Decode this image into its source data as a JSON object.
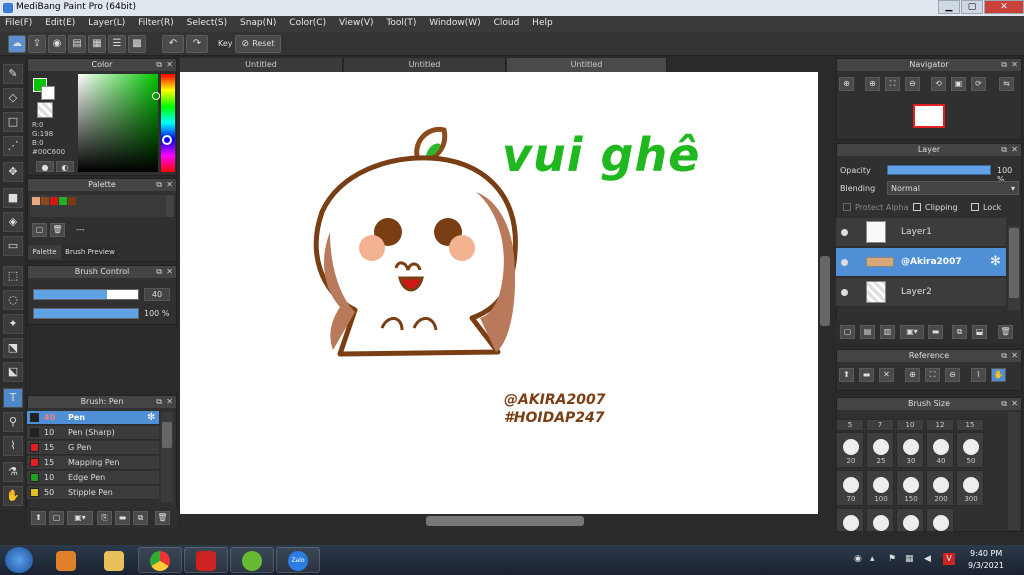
{
  "window": {
    "title": "MediBang Paint Pro (64bit)",
    "min": "▁",
    "max": "▢",
    "close": "✕"
  },
  "menu": [
    "File(F)",
    "Edit(E)",
    "Layer(L)",
    "Filter(R)",
    "Select(S)",
    "Snap(N)",
    "Color(C)",
    "View(V)",
    "Tool(T)",
    "Window(W)",
    "Cloud",
    "Help"
  ],
  "toolbar": {
    "key_label": "Key",
    "reset_label": "Reset"
  },
  "color_panel": {
    "title": "Color",
    "r": "R:0",
    "g": "G:198",
    "b": "B:0",
    "hex": "#00C600",
    "main_color": "#00c600"
  },
  "palette_panel": {
    "title": "Palette",
    "dash": "---",
    "tab_palette": "Palette",
    "tab_preview": "Brush Preview",
    "colors": [
      "#e9a77f",
      "#8b4a1c",
      "#d01818",
      "#22b022",
      "#7a3a14"
    ]
  },
  "brush_control": {
    "title": "Brush Control",
    "size": "40",
    "opacity": "100 %",
    "size_fraction": 0.7,
    "opacity_fraction": 1.0
  },
  "brush_panel": {
    "title": "Brush: Pen",
    "items": [
      {
        "size": "40",
        "name": "Pen",
        "color": "#222222"
      },
      {
        "size": "10",
        "name": "Pen (Sharp)",
        "color": "#222222"
      },
      {
        "size": "15",
        "name": "G Pen",
        "color": "#e02020"
      },
      {
        "size": "15",
        "name": "Mapping Pen",
        "color": "#e02020"
      },
      {
        "size": "10",
        "name": "Edge Pen",
        "color": "#20a020"
      },
      {
        "size": "50",
        "name": "Stipple Pen",
        "color": "#e0c020"
      }
    ]
  },
  "tabs": [
    "Untitled",
    "Untitled",
    "Untitled"
  ],
  "drawing": {
    "text1": "vui ghê",
    "text2": "@AKIRA2007",
    "text3": "#HOIDAP247"
  },
  "navigator": {
    "title": "Navigator"
  },
  "layer_panel": {
    "title": "Layer",
    "opacity_label": "Opacity",
    "opacity_value": "100 %",
    "blending_label": "Blending",
    "blending_value": "Normal",
    "protect_alpha": "Protect Alpha",
    "clipping": "Clipping",
    "lock": "Lock",
    "layers": [
      {
        "name": "Layer1"
      },
      {
        "name": "@Akira2007"
      },
      {
        "name": "Layer2"
      }
    ]
  },
  "reference": {
    "title": "Reference"
  },
  "brush_size": {
    "title": "Brush Size",
    "top_row": [
      "5",
      "7",
      "10",
      "12",
      "15"
    ],
    "rows": [
      [
        "20",
        "25",
        "30",
        "40",
        "50"
      ],
      [
        "70",
        "100",
        "150",
        "200",
        "300"
      ]
    ]
  },
  "taskbar": {
    "time": "9:40 PM",
    "date": "9/3/2021",
    "zalo": "Zalo"
  }
}
